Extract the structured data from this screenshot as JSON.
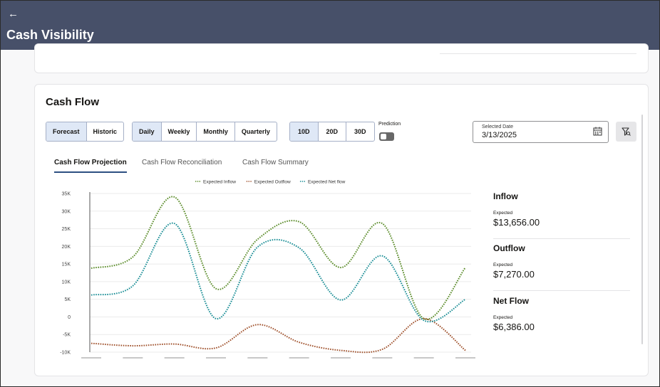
{
  "header": {
    "back_icon": "arrow-left-icon",
    "title": "Cash Visibility"
  },
  "card": {
    "title": "Cash Flow"
  },
  "source_toggle": [
    "Forecast",
    "Historic"
  ],
  "source_selected": "Forecast",
  "period_toggle": [
    "Daily",
    "Weekly",
    "Monthly",
    "Quarterly"
  ],
  "period_selected": "Daily",
  "range_toggle": [
    "10D",
    "20D",
    "30D"
  ],
  "range_selected": "10D",
  "prediction": {
    "label": "Prediction",
    "on": false
  },
  "date_field": {
    "label": "Selected Date",
    "value": "3/13/2025",
    "icon": "calendar-icon"
  },
  "filter_icon": "filter-icon",
  "tabs": [
    "Cash Flow Projection",
    "Cash Flow Reconciliation",
    "Cash Flow Summary"
  ],
  "active_tab": "Cash Flow Projection",
  "summary": {
    "inflow": {
      "title": "Inflow",
      "label": "Expected",
      "value": "$13,656.00"
    },
    "outflow": {
      "title": "Outflow",
      "label": "Expected",
      "value": "$7,270.00"
    },
    "netflow": {
      "title": "Net Flow",
      "label": "Expected",
      "value": "$6,386.00"
    }
  },
  "chart_data": {
    "type": "line",
    "y_ticks": [
      "35K",
      "30K",
      "25K",
      "20K",
      "15K",
      "10K",
      "5K",
      "0",
      "-5K",
      "-10K"
    ],
    "ylim": [
      -10000,
      35000
    ],
    "legend_position": "top",
    "gridlines": true,
    "series": [
      {
        "name": "Expected Inflow",
        "color": "#5b8c2a",
        "values": [
          13800,
          17000,
          34000,
          8000,
          22000,
          27000,
          14000,
          26500,
          -500,
          14000
        ]
      },
      {
        "name": "Expected Outflow",
        "color": "#a0522d",
        "values": [
          -7500,
          -8200,
          -7700,
          -8800,
          -2200,
          -7200,
          -9500,
          -9200,
          -500,
          -9500
        ]
      },
      {
        "name": "Expected Net flow",
        "color": "#1b8e96",
        "values": [
          6200,
          8800,
          26500,
          -500,
          19800,
          19600,
          4800,
          17300,
          -1000,
          5000
        ]
      }
    ]
  }
}
